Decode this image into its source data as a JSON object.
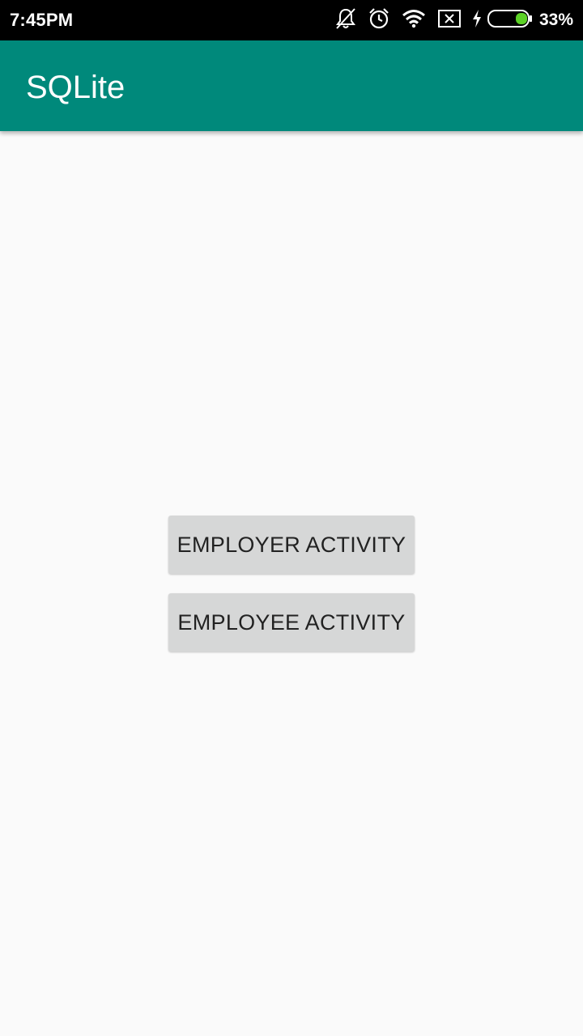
{
  "status_bar": {
    "time": "7:45PM",
    "battery_percent": "33%",
    "battery_level": 0.33,
    "battery_color": "#5cd126",
    "icons": [
      "bell-off-icon",
      "alarm-clock-icon",
      "wifi-icon",
      "sim-none-icon",
      "charging-bolt-icon",
      "battery-icon"
    ]
  },
  "app_bar": {
    "title": "SQLite",
    "color": "#00897b"
  },
  "main": {
    "buttons": [
      {
        "label": "EMPLOYER ACTIVITY"
      },
      {
        "label": "EMPLOYEE ACTIVITY"
      }
    ]
  }
}
